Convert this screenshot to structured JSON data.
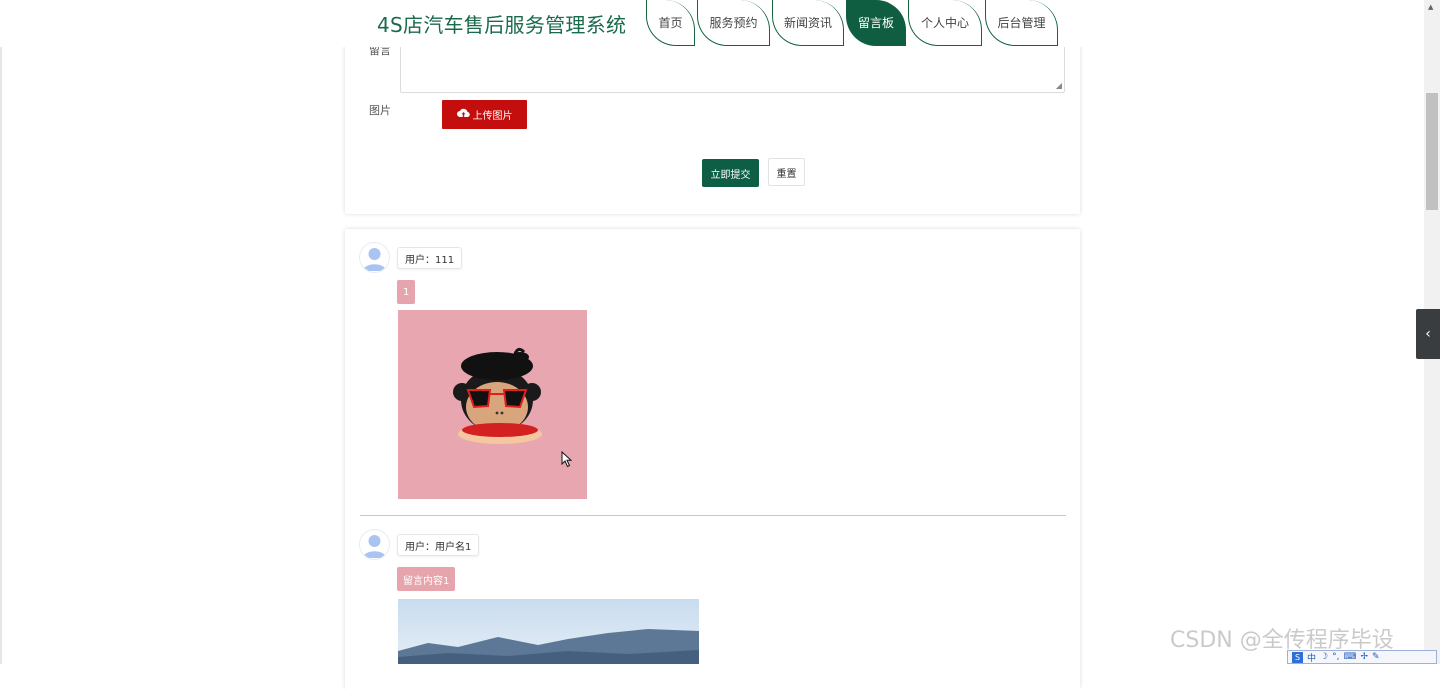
{
  "header": {
    "title": "4S店汽车售后服务管理系统",
    "nav": [
      "首页",
      "服务预约",
      "新闻资讯",
      "留言板",
      "个人中心",
      "后台管理"
    ],
    "active_index": 3
  },
  "form": {
    "content_label": "留言",
    "image_label": "图片",
    "upload_button": "上传图片",
    "submit_button": "立即提交",
    "reset_button": "重置"
  },
  "comments": [
    {
      "user": "用户：111",
      "content": "1",
      "image": "monkey-face-illustration"
    },
    {
      "user": "用户：用户名1",
      "content": "留言内容1",
      "image": "mountain-landscape-photo"
    }
  ],
  "watermark": "CSDN @全传程序毕设",
  "ime": {
    "mode": "中"
  },
  "colors": {
    "brand_green": "#0f5e42",
    "upload_red": "#c40d0d",
    "badge_pink": "#e6a4ad",
    "image_pink": "#e8a7b0"
  }
}
